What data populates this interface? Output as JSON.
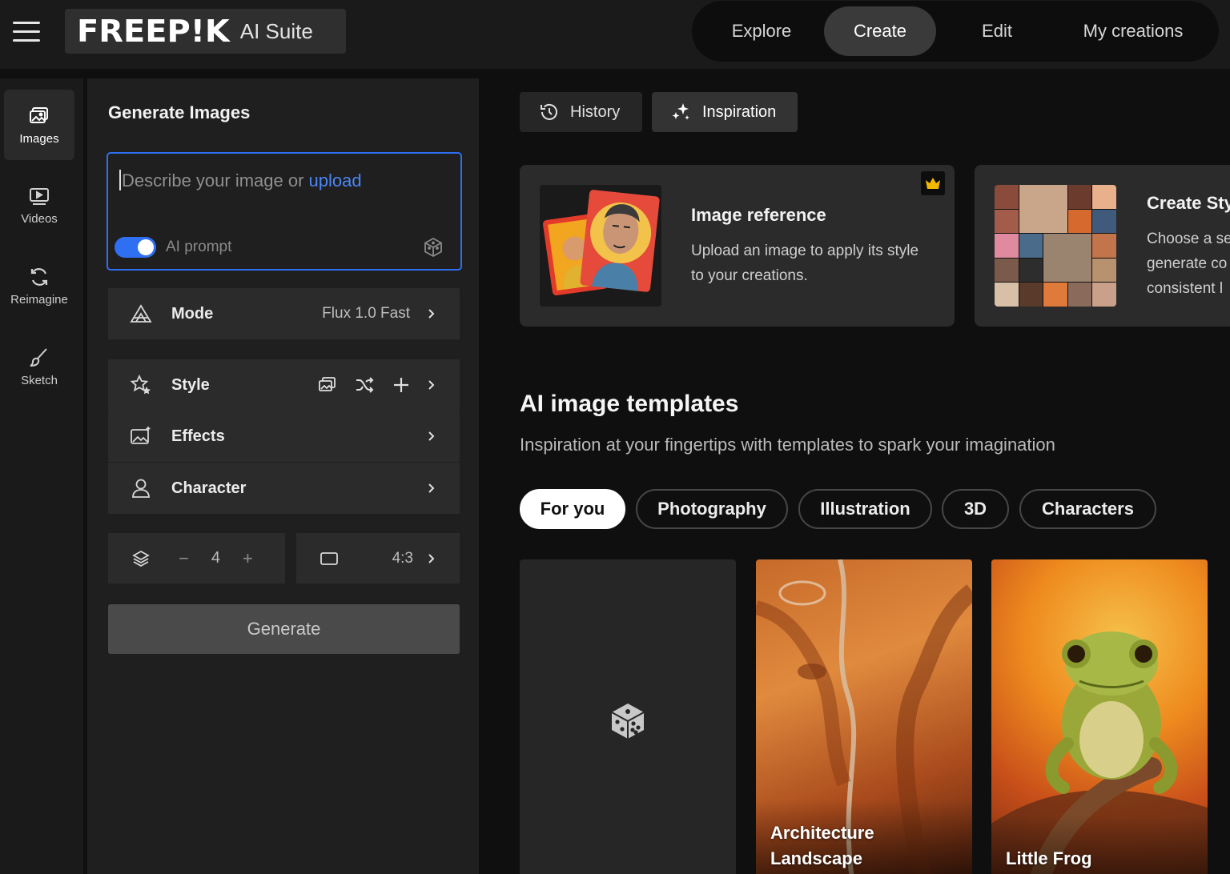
{
  "header": {
    "logo_text": "FREEP!K",
    "suite_label": "AI Suite",
    "nav": [
      {
        "label": "Explore",
        "active": false
      },
      {
        "label": "Create",
        "active": true
      },
      {
        "label": "Edit",
        "active": false
      },
      {
        "label": "My creations",
        "active": false
      }
    ]
  },
  "rail": {
    "items": [
      {
        "label": "Images",
        "icon": "image-icon",
        "active": true
      },
      {
        "label": "Videos",
        "icon": "video-icon",
        "active": false
      },
      {
        "label": "Reimagine",
        "icon": "refresh-icon",
        "active": false
      },
      {
        "label": "Sketch",
        "icon": "brush-icon",
        "active": false
      }
    ]
  },
  "panel": {
    "title": "Generate Images",
    "prompt": {
      "placeholder": "Describe your image or ",
      "upload_link": "upload",
      "ai_prompt_label": "AI prompt",
      "ai_prompt_enabled": true
    },
    "mode": {
      "label": "Mode",
      "value": "Flux 1.0 Fast"
    },
    "style": {
      "label": "Style"
    },
    "effects": {
      "label": "Effects"
    },
    "character": {
      "label": "Character"
    },
    "count": {
      "value": "4",
      "minus": "−",
      "plus": "+"
    },
    "aspect": {
      "value": "4:3"
    },
    "generate_label": "Generate"
  },
  "main": {
    "tabs": [
      {
        "label": "History",
        "icon": "history-icon",
        "active": false
      },
      {
        "label": "Inspiration",
        "icon": "sparkle-icon",
        "active": true
      }
    ],
    "cards": [
      {
        "title": "Image reference",
        "desc_line1": "Upload an image to apply its style",
        "desc_line2": "to your creations.",
        "premium": true
      },
      {
        "title": "Create Sty",
        "desc_line1": "Choose a se",
        "desc_line2": "generate co",
        "desc_line3": "consistent l"
      }
    ],
    "templates": {
      "title": "AI image templates",
      "subtitle": "Inspiration at your fingertips with templates to spark your imagination",
      "chips": [
        {
          "label": "For you",
          "active": true
        },
        {
          "label": "Photography",
          "active": false
        },
        {
          "label": "Illustration",
          "active": false
        },
        {
          "label": "3D",
          "active": false
        },
        {
          "label": "Characters",
          "active": false
        }
      ],
      "tiles": [
        {
          "label_line1": "",
          "label_line2": "",
          "kind": "random"
        },
        {
          "label_line1": "Architecture",
          "label_line2": "Landscape",
          "kind": "image"
        },
        {
          "label_line1": "",
          "label_line2": "Little Frog",
          "kind": "image"
        }
      ]
    }
  },
  "colors": {
    "accent_blue": "#2f6ff2",
    "link_blue": "#4b86f5",
    "crown_gold": "#f5b800",
    "background": "#0f0f0f"
  }
}
